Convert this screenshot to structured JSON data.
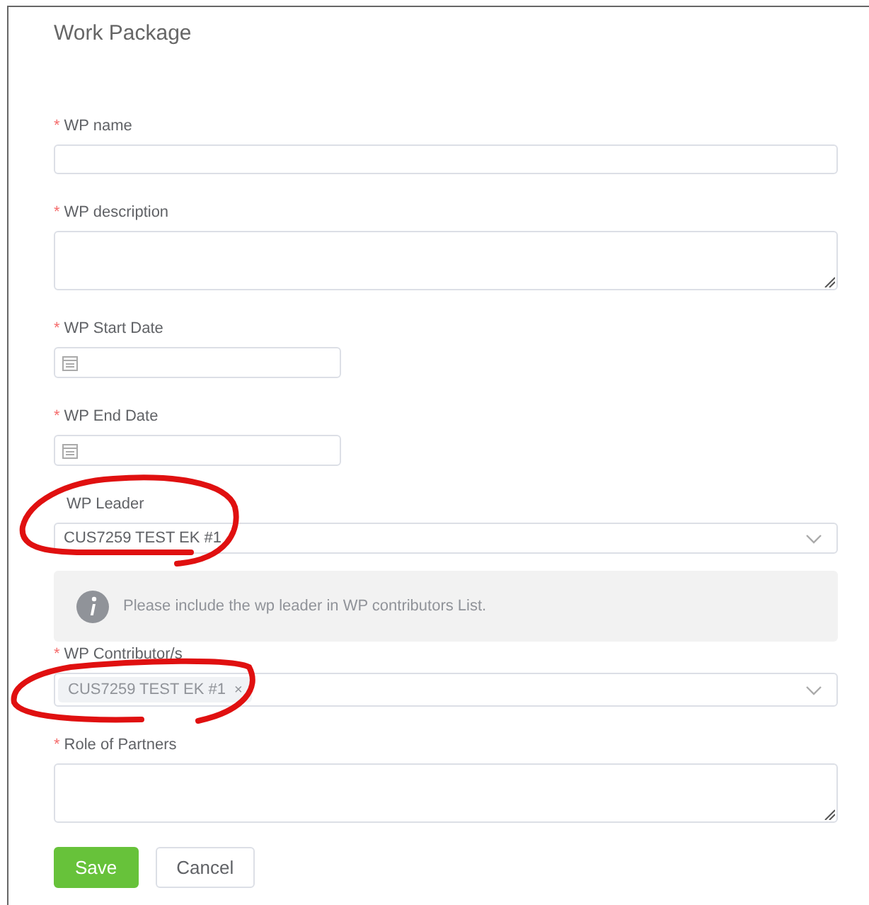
{
  "title": "Work Package",
  "fields": [
    {
      "kind": "text",
      "label": "WP name",
      "marker": "*"
    },
    {
      "kind": "textarea",
      "label": "WP description",
      "marker": "*"
    },
    {
      "kind": "date",
      "label": "WP Start Date",
      "marker": "*"
    },
    {
      "kind": "date",
      "label": "WP End Date",
      "marker": "*"
    },
    {
      "kind": "select",
      "label": "WP Leader",
      "value": "CUS7259 TEST EK #1"
    },
    {
      "kind": "notice",
      "text": "Please include the wp leader in WP contributors List."
    },
    {
      "kind": "multiselect",
      "label": "WP Contributor/s",
      "marker": "*",
      "tags": [
        {
          "text": "CUS7259 TEST EK #1",
          "remove": "×"
        }
      ]
    },
    {
      "kind": "textarea",
      "label": "Role of Partners",
      "marker": "*"
    }
  ],
  "buttons": [
    {
      "kind": "primary",
      "label": "Save"
    },
    {
      "kind": "default",
      "label": "Cancel"
    }
  ],
  "annotations": [
    {
      "kind": "scribble"
    },
    {
      "kind": "scribble"
    }
  ]
}
